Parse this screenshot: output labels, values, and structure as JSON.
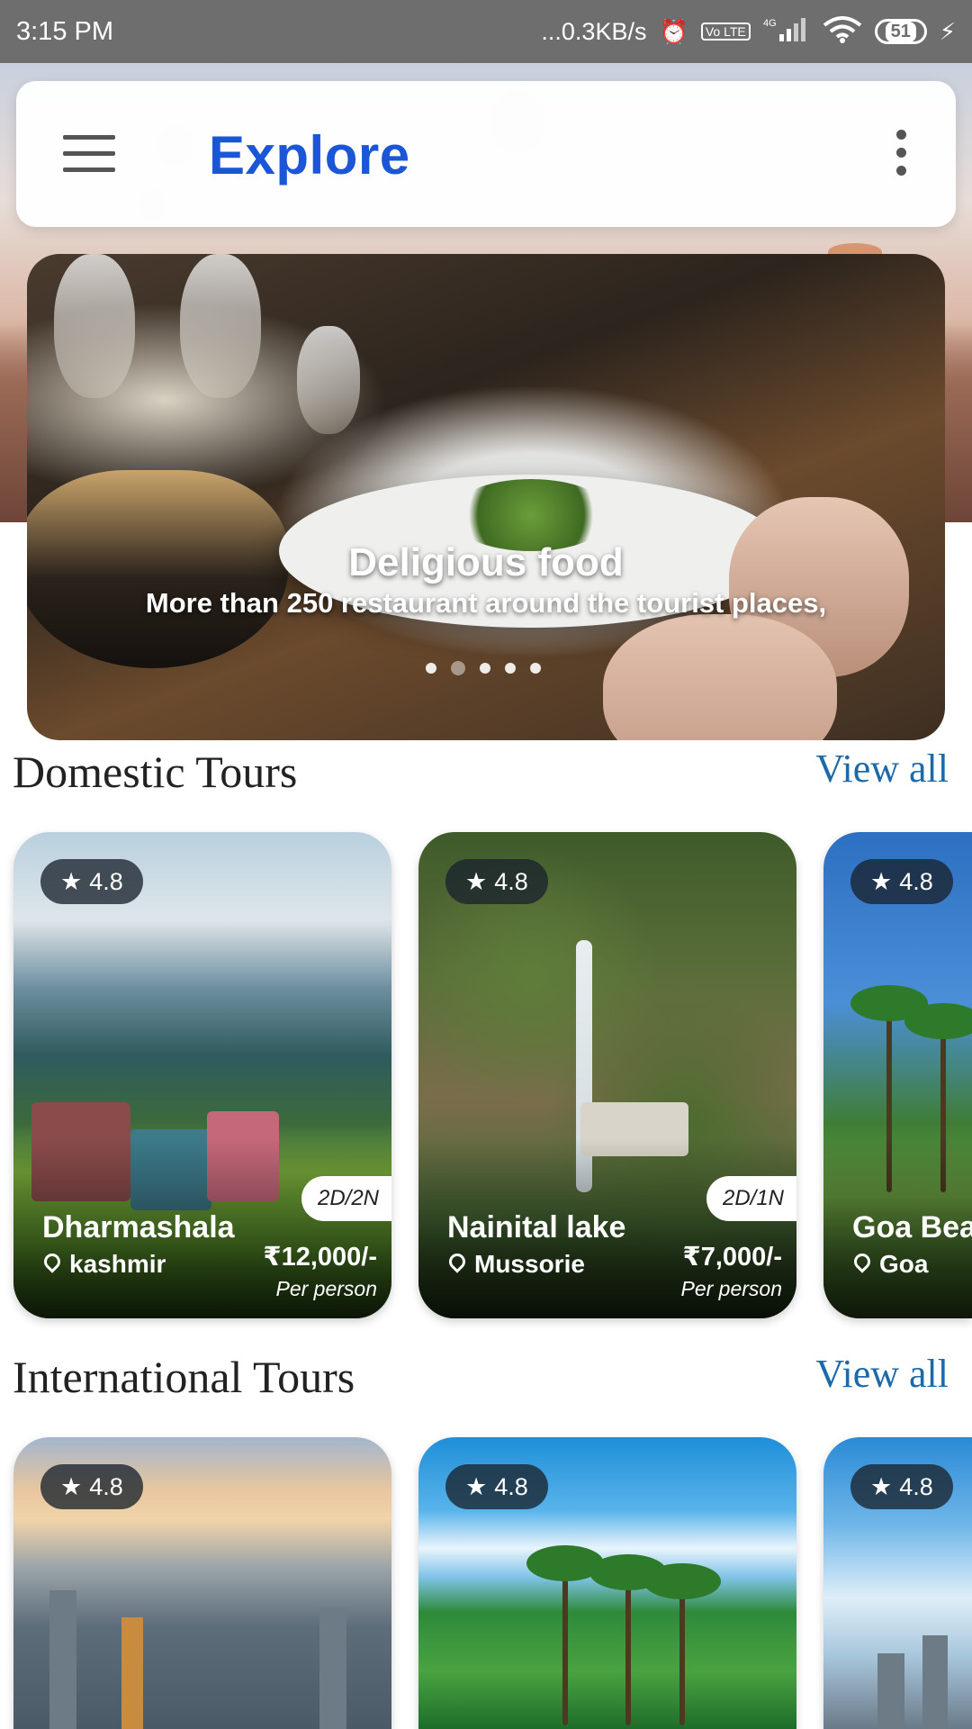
{
  "status_bar": {
    "time": "3:15 PM",
    "speed": "...0.3KB/s",
    "network": "4G",
    "volte": "Vo LTE",
    "battery": "51"
  },
  "app_bar": {
    "title": "Explore"
  },
  "banner": {
    "title": "Deligious food",
    "subtitle": "More than 250 restaurant around the tourist places,",
    "active_dot": 2,
    "dot_count": 5
  },
  "domestic": {
    "title": "Domestic Tours",
    "view_all": "View all",
    "cards": [
      {
        "rating": "4.8",
        "duration": "2D/2N",
        "name": "Dharmashala",
        "location": "kashmir",
        "price": "₹12,000/-",
        "per": "Per person"
      },
      {
        "rating": "4.8",
        "duration": "2D/1N",
        "name": "Nainital lake",
        "location": "Mussorie",
        "price": "₹7,000/-",
        "per": "Per person"
      },
      {
        "rating": "4.8",
        "name": "Goa Bea",
        "location": "Goa"
      }
    ]
  },
  "international": {
    "title": "International Tours",
    "view_all": "View all",
    "cards": [
      {
        "rating": "4.8"
      },
      {
        "rating": "4.8"
      },
      {
        "rating": "4.8"
      }
    ]
  },
  "icons": {
    "star": "★",
    "alarm": "⏰",
    "wifi": "wifi-icon",
    "charging": "⚡"
  }
}
